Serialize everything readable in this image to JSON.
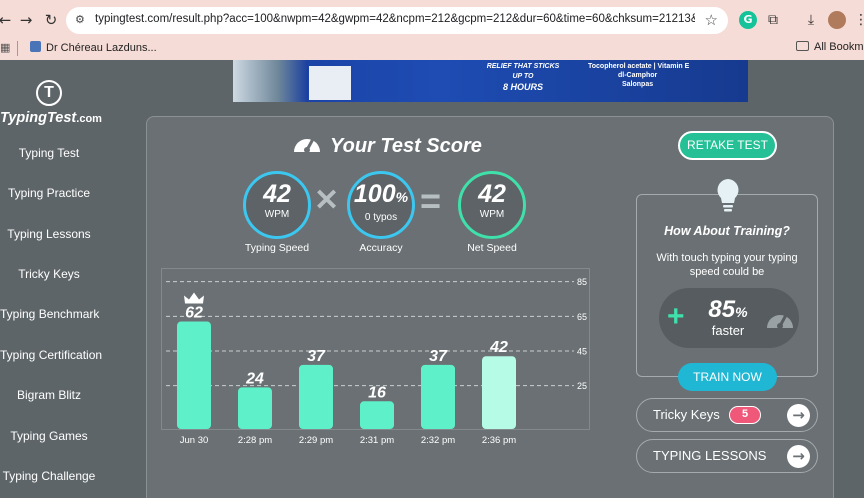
{
  "browser": {
    "url": "typingtest.com/result.php?acc=100&nwpm=42&gwpm=42&ncpm=212&gcpm=212&dur=60&time=60&chksum=21213&unit=wpm&...",
    "bookmark_item": "Dr Chéreau Lazduns...",
    "bookmarks_right": "All Bookmarks",
    "icons": [
      "back-icon",
      "forward-icon",
      "reload-icon",
      "site-info-icon",
      "star-icon",
      "grammarly-icon",
      "extensions-icon",
      "download-icon",
      "profile-avatar",
      "apps-icon",
      "folder-icon"
    ]
  },
  "ad": {
    "middle_line1": "RELIEF THAT STICKS",
    "middle_line2": "UP TO",
    "middle_line3": "8 HOURS",
    "right_line1": "Tocopherol acetate | Vitamin E",
    "right_line2": "dl-Camphor",
    "right_line3": "Salonpas"
  },
  "logo": {
    "main": "TypingTest",
    "suffix": ".com"
  },
  "sidebar": {
    "items": [
      {
        "label": "Typing Test"
      },
      {
        "label": "Typing Practice"
      },
      {
        "label": "Typing Lessons"
      },
      {
        "label": "Tricky Keys"
      },
      {
        "label": "Typing Benchmark"
      },
      {
        "label": "Typing Certification"
      },
      {
        "label": "Bigram Blitz"
      },
      {
        "label": "Typing Games"
      },
      {
        "label": "Typing Challenge"
      }
    ]
  },
  "score": {
    "title": "Your Test Score",
    "retake_label": "RETAKE TEST",
    "typing_speed": {
      "value": "42",
      "unit": "WPM",
      "caption": "Typing Speed"
    },
    "accuracy": {
      "value": "100",
      "unit": "%",
      "sub": "0 typos",
      "caption": "Accuracy"
    },
    "net_speed": {
      "value": "42",
      "unit": "WPM",
      "caption": "Net Speed"
    }
  },
  "chart_data": {
    "type": "bar",
    "categories": [
      "Jun 30",
      "2:28 pm",
      "2:29 pm",
      "2:31 pm",
      "2:32 pm",
      "2:36 pm"
    ],
    "values": [
      62,
      24,
      37,
      16,
      37,
      42
    ],
    "data_labels": [
      "62",
      "24",
      "37",
      "16",
      "37",
      "42"
    ],
    "gridlines": [
      85,
      65,
      45,
      25
    ],
    "ylim": [
      0,
      90
    ],
    "best_index": 0,
    "colors": {
      "bar": "#5ef0c8",
      "latest": "#b6fbe5",
      "grid": "#c9cfd2"
    }
  },
  "training": {
    "title": "How About Training?",
    "subtitle": "With touch typing your typing speed could be",
    "percent": "85",
    "percent_unit": "%",
    "faster": "faster",
    "button": "TRAIN NOW"
  },
  "tricky_keys": {
    "label": "Tricky Keys",
    "count": "5"
  },
  "typing_lessons": {
    "label": "TYPING LESSONS"
  },
  "colors": {
    "accent_green": "#25c095",
    "accent_cyan": "#3cc7f0",
    "background": "#5e6568",
    "badge": "#f0587a"
  }
}
